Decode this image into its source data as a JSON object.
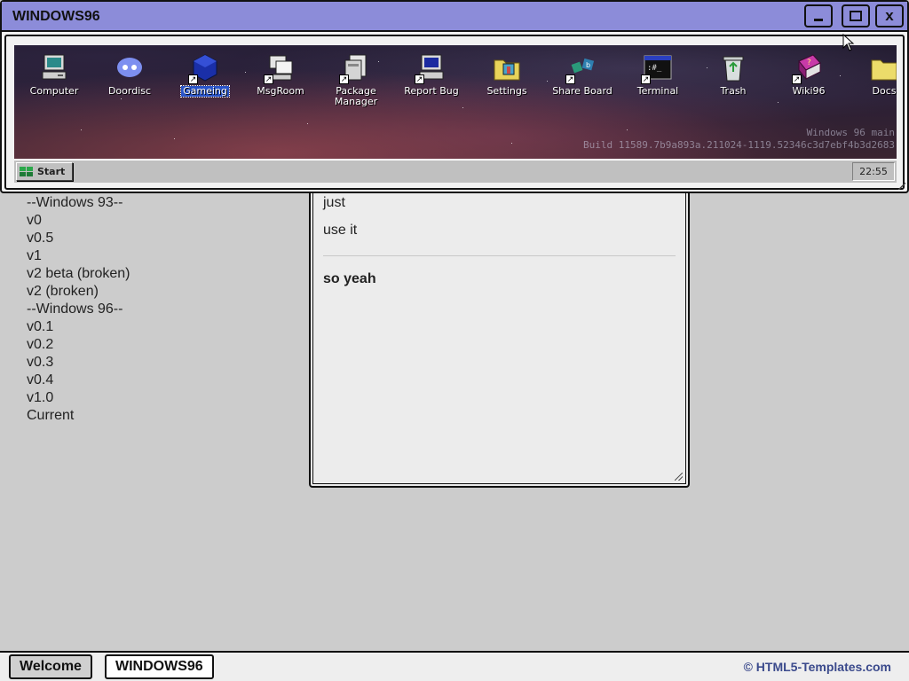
{
  "version_list": [
    "--Windows 93--",
    "v0",
    "v0.5",
    "v1",
    "v2 beta (broken)",
    "v2 (broken)",
    "--Windows 96--",
    "v0.1",
    "v0.2",
    "v0.3",
    "v0.4",
    "v1.0",
    "Current"
  ],
  "content_panel": {
    "line1": "just",
    "line2": "use it",
    "line3": "so yeah"
  },
  "window": {
    "title": "WINDOWS96",
    "minimize_label": "_",
    "maximize_label": "□",
    "close_label": "x"
  },
  "desktop": {
    "icons": [
      {
        "label": "Computer",
        "icon": "computer-icon"
      },
      {
        "label": "Doordisc",
        "icon": "discord-icon"
      },
      {
        "label": "Gameing",
        "icon": "game-cube-icon",
        "selected": true
      },
      {
        "label": "MsgRoom",
        "icon": "msgroom-icon"
      },
      {
        "label": "Package Manager",
        "icon": "package-manager-icon"
      },
      {
        "label": "Report Bug",
        "icon": "report-bug-icon"
      },
      {
        "label": "Settings",
        "icon": "settings-icon"
      },
      {
        "label": "Share Board",
        "icon": "share-board-icon"
      },
      {
        "label": "Terminal",
        "icon": "terminal-icon"
      },
      {
        "label": "Trash",
        "icon": "trash-icon"
      },
      {
        "label": "Wiki96",
        "icon": "wiki-book-icon"
      },
      {
        "label": "Docs",
        "icon": "folder-icon"
      }
    ],
    "build_line1": "Windows 96 main",
    "build_line2": "Build 11589.7b9a893a.211024-1119.52346c3d7ebf4b3d2683"
  },
  "taskbar": {
    "start_label": "Start",
    "clock": "22:55"
  },
  "bottom_bar": {
    "welcome_label": "Welcome",
    "windows96_label": "WINDOWS96",
    "credit": "© HTML5-Templates.com"
  }
}
